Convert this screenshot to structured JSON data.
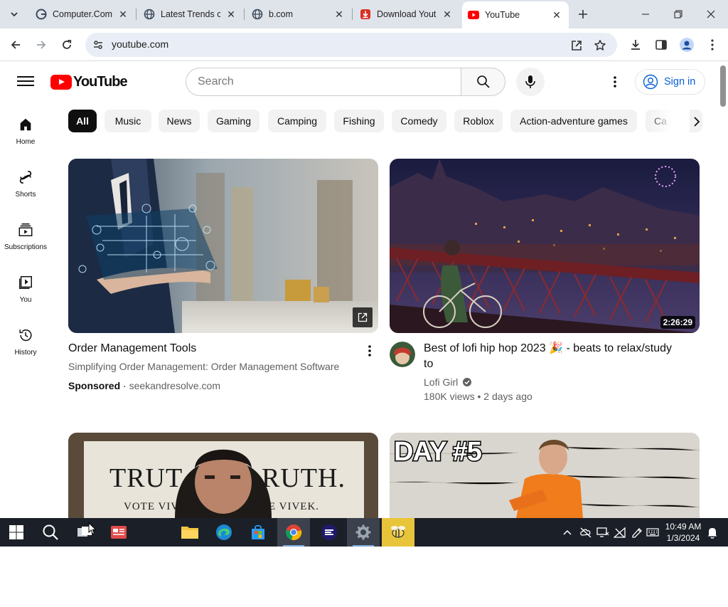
{
  "browser": {
    "tabs": [
      {
        "title": "Computer.Com",
        "active": false
      },
      {
        "title": "Latest Trends c",
        "active": false
      },
      {
        "title": "b.com",
        "active": false
      },
      {
        "title": "Download Yout",
        "active": false
      },
      {
        "title": "YouTube",
        "active": true
      }
    ],
    "url": "youtube.com"
  },
  "youtube": {
    "logo_text": "YouTube",
    "search_placeholder": "Search",
    "sign_in": "Sign in",
    "sidebar": [
      {
        "label": "Home",
        "icon": "home-icon"
      },
      {
        "label": "Shorts",
        "icon": "shorts-icon"
      },
      {
        "label": "Subscriptions",
        "icon": "subscriptions-icon"
      },
      {
        "label": "You",
        "icon": "you-icon"
      },
      {
        "label": "History",
        "icon": "history-icon"
      }
    ],
    "chips": [
      "All",
      "Music",
      "News",
      "Gaming",
      "Camping",
      "Fishing",
      "Comedy",
      "Roblox",
      "Action-adventure games",
      "Ca"
    ],
    "videos": [
      {
        "title": "Order Management Tools",
        "description": "Simplifying Order Management: Order Management Software",
        "sponsored": "Sponsored",
        "domain": "seekandresolve.com"
      },
      {
        "title_line1": "Best of lofi hip hop 2023 🎉 - beats to relax/study",
        "title_line2": "to",
        "channel": "Lofi Girl",
        "stats": "180K views • 2 days ago",
        "duration": "2:26:29"
      },
      {
        "thumb_text_top": "TRUT",
        "thumb_text_right": "RUTH.",
        "thumb_text_bottom_left": "VOTE VIVI",
        "thumb_text_bottom_right": "OTE VIVEK."
      },
      {
        "thumb_text": "DAY #5"
      }
    ]
  },
  "taskbar": {
    "time": "10:49 AM",
    "date": "1/3/2024"
  }
}
